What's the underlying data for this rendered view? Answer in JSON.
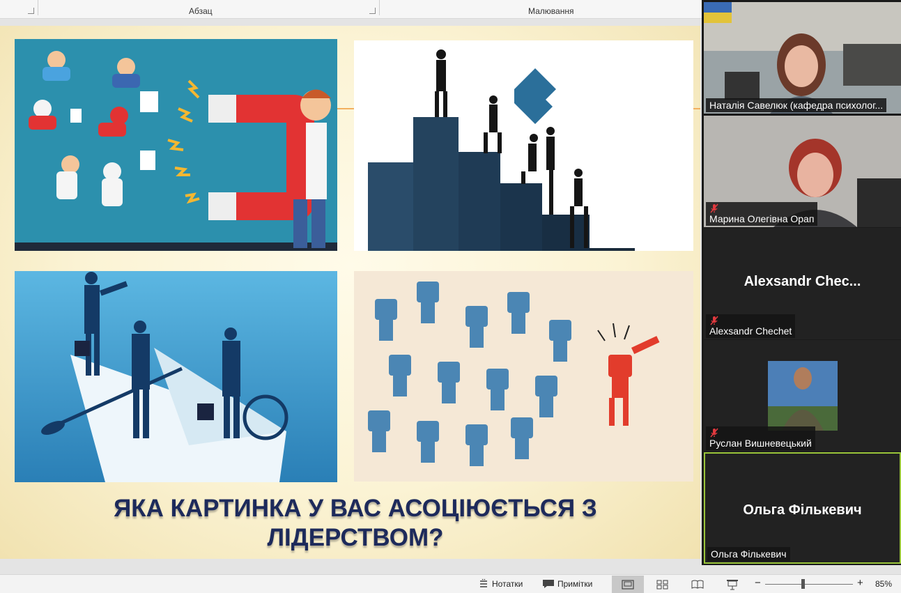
{
  "ribbon": {
    "group_paragraph": "Абзац",
    "group_drawing": "Малювання"
  },
  "slide": {
    "title": "Яка картинка у вас асоціюється з лідерством?",
    "colors": {
      "title": "#1d2a5b",
      "accent_line": "#f2b060"
    },
    "pictures": [
      {
        "name": "magnet-attracting-people-illustration"
      },
      {
        "name": "puzzle-pieces-teamwork-silhouette"
      },
      {
        "name": "businesspeople-paper-boat-illustration"
      },
      {
        "name": "leader-pointing-crowd-illustration"
      }
    ]
  },
  "participants": [
    {
      "name": "Наталія Савелюк (кафедра психолог...",
      "video": true,
      "muted": false
    },
    {
      "name": "Марина Олегівна Орап",
      "video": true,
      "muted": true
    },
    {
      "name": "Alexsandr Chechet",
      "display": "Alexsandr  Chec...",
      "video": false,
      "muted": true
    },
    {
      "name": "Руслан Вишневецький",
      "video": true,
      "muted": true
    },
    {
      "name": "Ольга Фількевич",
      "display": "Ольга Фількевич",
      "video": false,
      "muted": false,
      "active_speaker": true
    }
  ],
  "statusbar": {
    "notes_label": "Нотатки",
    "comments_label": "Примітки",
    "zoom_level": "85%",
    "zoom_minus": "−",
    "zoom_plus": "+"
  }
}
